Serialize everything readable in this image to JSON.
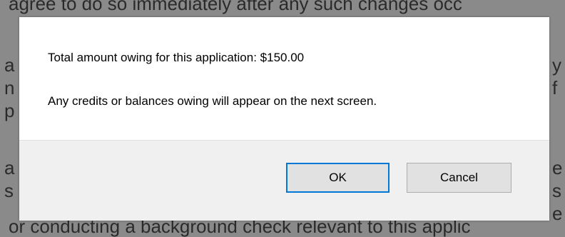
{
  "background": {
    "top_line": "agree to do so immediately after any such changes occ",
    "bottom_line": "or conducting a background check relevant to this applic",
    "left_fragments": [
      "a",
      "n",
      "p",
      "a",
      "s"
    ],
    "right_fragments": [
      "y",
      "f",
      "e",
      "s",
      "e"
    ]
  },
  "dialog": {
    "message_total": "Total amount owing for this application: $150.00",
    "message_credits": "Any credits or balances owing will appear on the next screen.",
    "ok_label": "OK",
    "cancel_label": "Cancel"
  },
  "colors": {
    "focus_border": "#0078d7",
    "footer_bg": "#f0f0f0",
    "button_bg": "#e1e1e1"
  }
}
